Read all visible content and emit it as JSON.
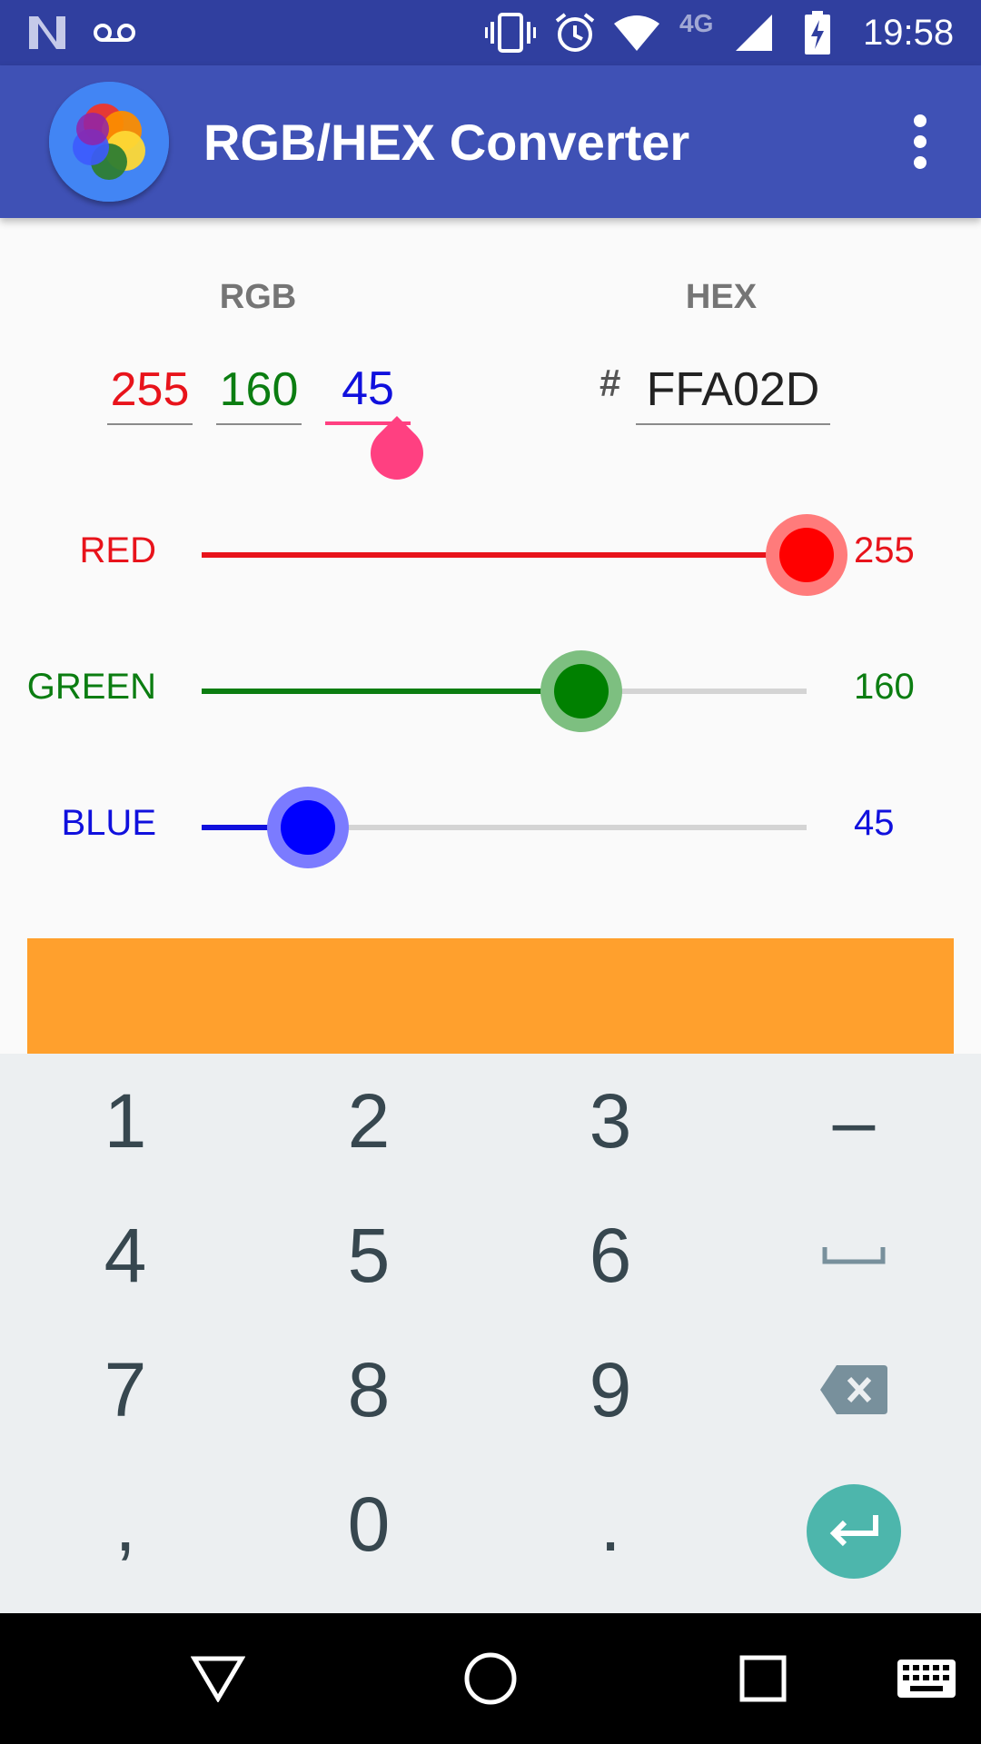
{
  "status_bar": {
    "time": "19:58",
    "network": "4G",
    "icons": [
      "n-logo-icon",
      "voicemail-icon",
      "vibrate-icon",
      "alarm-icon",
      "wifi-icon",
      "signal-icon",
      "battery-charging-icon"
    ]
  },
  "app_bar": {
    "title": "RGB/HEX Converter",
    "logo_icon": "color-wheel-icon",
    "menu_icon": "more-vert-icon"
  },
  "converter": {
    "rgb_label": "RGB",
    "hex_label": "HEX",
    "red_value": "255",
    "green_value": "160",
    "blue_value": "45",
    "hash": "#",
    "hex_value": "FFA02D"
  },
  "sliders": [
    {
      "label": "RED",
      "value": "255",
      "fraction": 1.0,
      "color": "#e8131b",
      "fill_color": "#e8131b",
      "thumb_color": "#ff0000",
      "halo_color": "#ff7b7b"
    },
    {
      "label": "GREEN",
      "value": "160",
      "fraction": 0.627,
      "color": "#0b7d11",
      "fill_color": "#0b7d11",
      "thumb_color": "#008000",
      "halo_color": "#7dbf80"
    },
    {
      "label": "BLUE",
      "value": "45",
      "fraction": 0.176,
      "color": "#1010dd",
      "fill_color": "#1010dd",
      "thumb_color": "#0000ff",
      "halo_color": "#7b7bff"
    }
  ],
  "preview": {
    "color": "#ffa02d"
  },
  "keyboard": {
    "rows": [
      [
        "1",
        "2",
        "3",
        "–"
      ],
      [
        "4",
        "5",
        "6",
        "␣"
      ],
      [
        "7",
        "8",
        "9",
        "⌫"
      ],
      [
        ",",
        "0",
        ".",
        ""
      ]
    ],
    "enter_icon": "enter-arrow-icon"
  },
  "nav_bar": {
    "icons": [
      "back-icon",
      "home-icon",
      "recents-icon",
      "keyboard-switch-icon"
    ]
  }
}
